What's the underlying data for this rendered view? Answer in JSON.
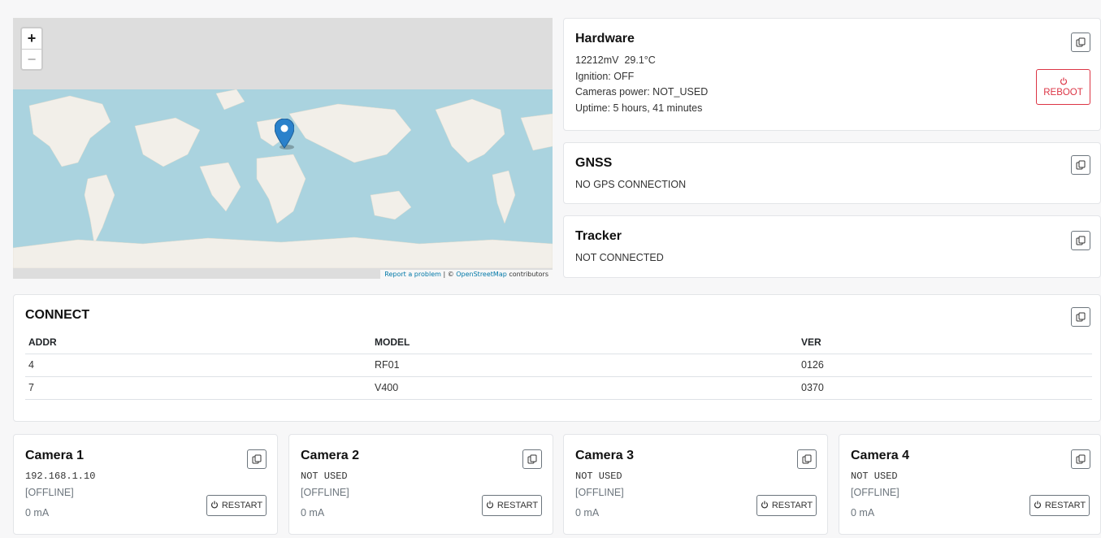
{
  "map": {
    "zoom_in": "+",
    "zoom_out": "−",
    "attribution_report": "Report a problem",
    "attribution_sep": " | © ",
    "attribution_osm": "OpenStreetMap",
    "attribution_contrib": " contributors"
  },
  "hardware": {
    "title": "Hardware",
    "voltage_temp": "12212mV  29.1°C",
    "ignition": "Ignition: OFF",
    "cameras_power": "Cameras power: NOT_USED",
    "uptime": "Uptime: 5 hours, 41 minutes",
    "reboot_label": "REBOOT"
  },
  "gnss": {
    "title": "GNSS",
    "status": "NO GPS CONNECTION"
  },
  "tracker": {
    "title": "Tracker",
    "status": "NOT CONNECTED"
  },
  "connect": {
    "title": "CONNECT",
    "columns": [
      "ADDR",
      "MODEL",
      "VER"
    ],
    "rows": [
      [
        "4",
        "RF01",
        "0126"
      ],
      [
        "7",
        "V400",
        "0370"
      ]
    ]
  },
  "cameras": [
    {
      "title": "Camera 1",
      "address": "192.168.1.10",
      "status": "[OFFLINE]",
      "current": "0 mA",
      "restart_label": "RESTART"
    },
    {
      "title": "Camera 2",
      "address": "NOT USED",
      "status": "[OFFLINE]",
      "current": "0 mA",
      "restart_label": "RESTART"
    },
    {
      "title": "Camera 3",
      "address": "NOT USED",
      "status": "[OFFLINE]",
      "current": "0 mA",
      "restart_label": "RESTART"
    },
    {
      "title": "Camera 4",
      "address": "NOT USED",
      "status": "[OFFLINE]",
      "current": "0 mA",
      "restart_label": "RESTART"
    }
  ],
  "colors": {
    "ocean": "#aad3df",
    "land": "#f2efe9",
    "map_bg": "#dddddd",
    "marker": "#2a81cb",
    "danger": "#dc3545"
  },
  "icons": {
    "copy": "copy-icon",
    "power": "power-icon",
    "marker": "map-marker-icon"
  }
}
